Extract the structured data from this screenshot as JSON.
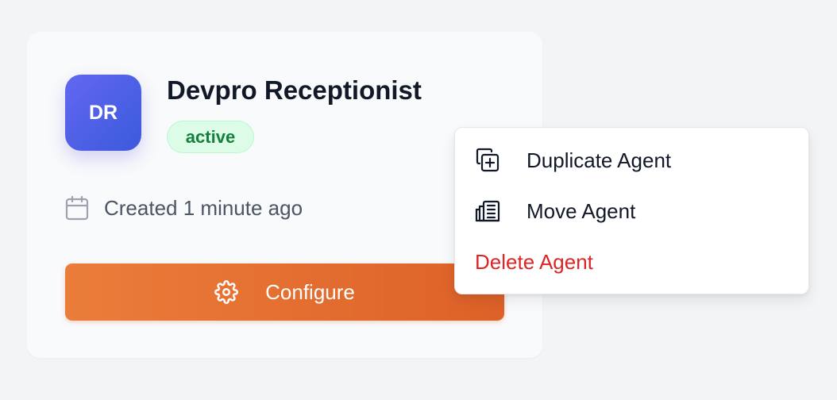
{
  "agent": {
    "initials": "DR",
    "name": "Devpro Receptionist",
    "status": "active",
    "created": "Created 1 minute ago"
  },
  "actions": {
    "configure_label": "Configure"
  },
  "menu": {
    "items": [
      {
        "label": "Duplicate Agent",
        "icon": "duplicate-icon"
      },
      {
        "label": "Move Agent",
        "icon": "move-icon"
      },
      {
        "label": "Delete Agent",
        "icon": null
      }
    ]
  },
  "colors": {
    "avatar_gradient_start": "#6366f1",
    "avatar_gradient_end": "#3b5bdb",
    "status_active_bg": "#dcfce7",
    "status_active_text": "#15803d",
    "configure_gradient_start": "#eb7d3a",
    "configure_gradient_end": "#dd6128",
    "delete_text": "#dc2626"
  }
}
